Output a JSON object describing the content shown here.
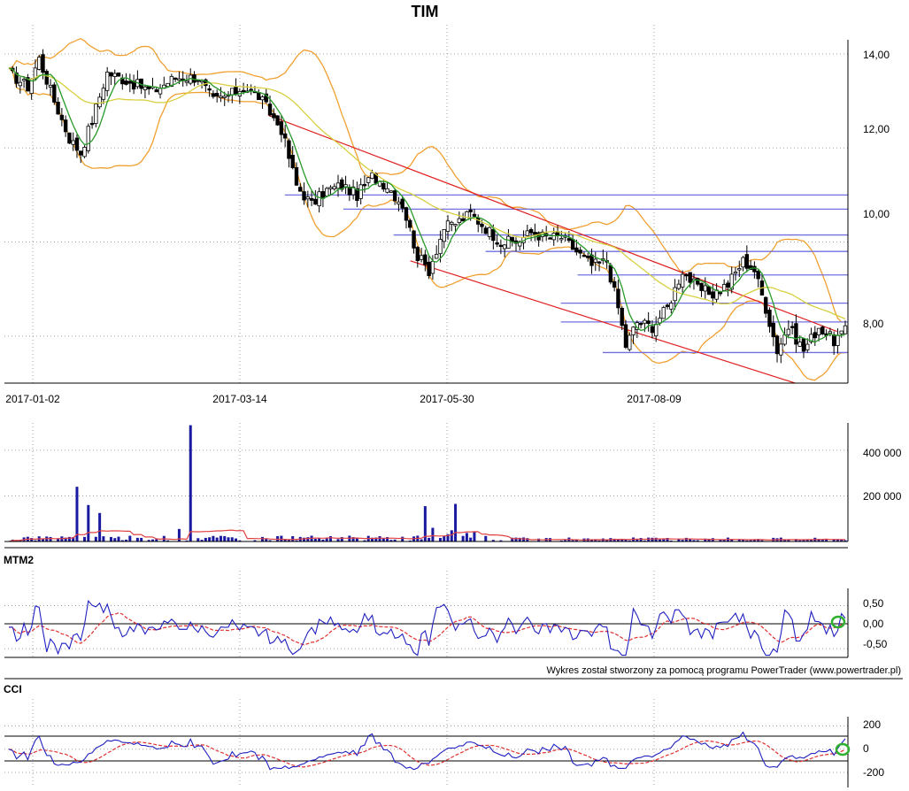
{
  "title": "TIM",
  "credit": "Wykres został stworzony za pomocą programu PowerTrader (www.powertrader.pl)",
  "colors": {
    "candle_up": "#ffffff",
    "candle_down": "#000000",
    "bollinger": "#f0a030",
    "ma_short": "#2a9a2a",
    "ma_long": "#d8d040",
    "support_lines": "#7070e0",
    "trend_lines": "#e02020",
    "volume_bars": "#1a1aa0",
    "volume_avg": "#e04040",
    "indicator_line": "#2020c0",
    "signal_line": "#e03030",
    "marker": "#30b030",
    "grid": "#a0a0a0"
  },
  "chart_data": [
    {
      "panel": "price",
      "type": "candlestick",
      "title": "TIM",
      "x_ticks": [
        "2017-01-02",
        "2017-03-14",
        "2017-05-30",
        "2017-08-09"
      ],
      "y_ticks": [
        "14,00",
        "12,00",
        "10,00",
        "8,00"
      ],
      "ylim": [
        7.0,
        14.3
      ],
      "grid": true,
      "overlays": [
        "bollinger-bands",
        "moving-average-short",
        "moving-average-long"
      ],
      "close_path": [
        {
          "i": 0,
          "v": 13.6
        },
        {
          "i": 5,
          "v": 13.3
        },
        {
          "i": 8,
          "v": 13.9
        },
        {
          "i": 12,
          "v": 13.0
        },
        {
          "i": 16,
          "v": 12.2
        },
        {
          "i": 19,
          "v": 11.9
        },
        {
          "i": 22,
          "v": 12.6
        },
        {
          "i": 26,
          "v": 13.6
        },
        {
          "i": 32,
          "v": 13.4
        },
        {
          "i": 38,
          "v": 13.2
        },
        {
          "i": 44,
          "v": 13.5
        },
        {
          "i": 50,
          "v": 13.5
        },
        {
          "i": 54,
          "v": 13.0
        },
        {
          "i": 58,
          "v": 13.1
        },
        {
          "i": 62,
          "v": 13.3
        },
        {
          "i": 66,
          "v": 13.1
        },
        {
          "i": 72,
          "v": 12.4
        },
        {
          "i": 76,
          "v": 11.2
        },
        {
          "i": 80,
          "v": 10.8
        },
        {
          "i": 84,
          "v": 11.1
        },
        {
          "i": 88,
          "v": 11.2
        },
        {
          "i": 92,
          "v": 11.0
        },
        {
          "i": 96,
          "v": 11.4
        },
        {
          "i": 100,
          "v": 11.2
        },
        {
          "i": 104,
          "v": 10.8
        },
        {
          "i": 108,
          "v": 9.7
        },
        {
          "i": 111,
          "v": 9.4
        },
        {
          "i": 115,
          "v": 10.3
        },
        {
          "i": 118,
          "v": 10.4
        },
        {
          "i": 122,
          "v": 10.6
        },
        {
          "i": 126,
          "v": 10.3
        },
        {
          "i": 130,
          "v": 10.0
        },
        {
          "i": 134,
          "v": 10.0
        },
        {
          "i": 138,
          "v": 10.2
        },
        {
          "i": 142,
          "v": 10.1
        },
        {
          "i": 146,
          "v": 10.1
        },
        {
          "i": 150,
          "v": 9.8
        },
        {
          "i": 154,
          "v": 9.5
        },
        {
          "i": 158,
          "v": 9.6
        },
        {
          "i": 161,
          "v": 8.6
        },
        {
          "i": 163,
          "v": 7.8
        },
        {
          "i": 166,
          "v": 8.3
        },
        {
          "i": 170,
          "v": 8.2
        },
        {
          "i": 174,
          "v": 8.6
        },
        {
          "i": 178,
          "v": 9.4
        },
        {
          "i": 182,
          "v": 9.0
        },
        {
          "i": 186,
          "v": 8.9
        },
        {
          "i": 190,
          "v": 9.1
        },
        {
          "i": 194,
          "v": 9.6
        },
        {
          "i": 197,
          "v": 9.4
        },
        {
          "i": 200,
          "v": 8.6
        },
        {
          "i": 203,
          "v": 7.7
        },
        {
          "i": 206,
          "v": 8.2
        },
        {
          "i": 210,
          "v": 7.7
        },
        {
          "i": 214,
          "v": 8.2
        },
        {
          "i": 218,
          "v": 7.9
        },
        {
          "i": 221,
          "v": 8.1
        }
      ],
      "horizontal_lines": [
        {
          "y": 11.0,
          "from": 0.33
        },
        {
          "y": 10.7,
          "from": 0.4
        },
        {
          "y": 10.15,
          "from": 0.46
        },
        {
          "y": 9.8,
          "from": 0.57
        },
        {
          "y": 9.3,
          "from": 0.68
        },
        {
          "y": 8.7,
          "from": 0.66
        },
        {
          "y": 8.3,
          "from": 0.66
        },
        {
          "y": 7.65,
          "from": 0.71
        }
      ],
      "trend_lines": [
        {
          "from": [
            0.31,
            12.7
          ],
          "to": [
            0.99,
            8.1
          ]
        },
        {
          "from": [
            0.48,
            9.6
          ],
          "to": [
            0.94,
            7.0
          ]
        }
      ]
    },
    {
      "panel": "volume",
      "type": "bar",
      "y_ticks": [
        "400 000",
        "200 000"
      ],
      "ylim": [
        0,
        520000
      ],
      "spikes": [
        {
          "i": 18,
          "v": 240000
        },
        {
          "i": 21,
          "v": 160000
        },
        {
          "i": 24,
          "v": 125000
        },
        {
          "i": 45,
          "v": 55000
        },
        {
          "i": 48,
          "v": 510000
        },
        {
          "i": 110,
          "v": 155000
        },
        {
          "i": 112,
          "v": 60000
        },
        {
          "i": 118,
          "v": 165000
        }
      ]
    },
    {
      "panel": "indicator",
      "type": "line",
      "title": "MTM2",
      "y_ticks": [
        "0,50",
        "0,00",
        "-0,50"
      ],
      "ylim": [
        -0.7,
        0.9
      ]
    },
    {
      "panel": "indicator",
      "type": "line",
      "title": "CCI",
      "y_ticks": [
        "200",
        "0",
        "-200"
      ],
      "ylim": [
        -330,
        280
      ],
      "reference_levels": [
        100,
        -100
      ]
    }
  ]
}
